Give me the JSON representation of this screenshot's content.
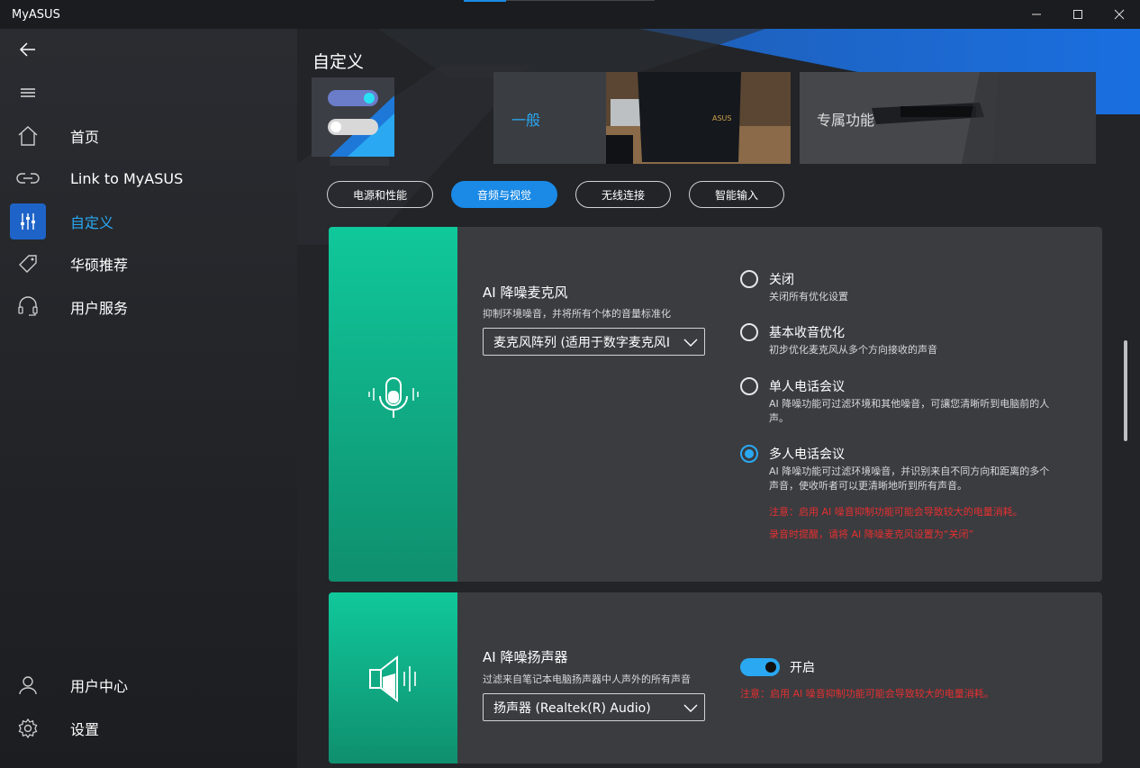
{
  "window": {
    "title": "MyASUS",
    "minimize_icon": "minimize-icon",
    "maximize_icon": "maximize-icon",
    "close_icon": "close-icon"
  },
  "sidebar": {
    "back_icon": "back-arrow-icon",
    "menu_icon": "hamburger-icon",
    "items": [
      {
        "label": "首页",
        "icon": "home-icon"
      },
      {
        "label": "Link to MyASUS",
        "icon": "link-icon"
      },
      {
        "label": "自定义",
        "icon": "sliders-icon",
        "active": true
      },
      {
        "label": "华硕推荐",
        "icon": "tag-icon"
      },
      {
        "label": "用户服务",
        "icon": "headset-icon"
      }
    ],
    "bottom_items": [
      {
        "label": "用户中心",
        "icon": "user-icon"
      },
      {
        "label": "设置",
        "icon": "gear-icon"
      }
    ]
  },
  "main": {
    "page_title": "自定义",
    "cards": {
      "general": "一般",
      "exclusive": "专属功能"
    },
    "tabs": [
      {
        "label": "电源和性能",
        "active": false
      },
      {
        "label": "音频与视觉",
        "active": true
      },
      {
        "label": "无线连接",
        "active": false
      },
      {
        "label": "智能输入",
        "active": false
      }
    ],
    "mic_panel": {
      "title": "AI 降噪麦克风",
      "desc": "抑制环境噪音，并将所有个体的音量标准化",
      "select_value": "麦克风阵列 (适用于数字麦克风I",
      "options": [
        {
          "title": "关闭",
          "desc": "关闭所有优化设置",
          "checked": false
        },
        {
          "title": "基本收音优化",
          "desc": "初步优化麦克风从多个方向接收的声音",
          "checked": false
        },
        {
          "title": "单人电话会议",
          "desc": "AI 降噪功能可过滤环境和其他噪音，可讓您清晰听到电脑前的人声。",
          "checked": false
        },
        {
          "title": "多人电话会议",
          "desc": "AI 降噪功能可过滤环境噪音，并识别来自不同方向和距离的多个声音，使收听者可以更清晰地听到所有声音。",
          "checked": true
        }
      ],
      "warning_1": "注意：启用 AI 噪音抑制功能可能会导致较大的电量消耗。",
      "warning_2": "录音时提醒，请将 AI 降噪麦克风设置为“关闭”"
    },
    "speaker_panel": {
      "title": "AI 降噪扬声器",
      "desc": "过滤来自笔记本电脑扬声器中人声外的所有声音",
      "select_value": "扬声器 (Realtek(R) Audio)",
      "toggle_on": true,
      "toggle_label": "开启",
      "warning": "注意：启用 AI 噪音抑制功能可能会导致较大的电量消耗。"
    }
  },
  "colors": {
    "accent": "#1a8ae6",
    "active_text": "#2aa8f2",
    "green": "#10c89b",
    "warning": "#e53030"
  }
}
